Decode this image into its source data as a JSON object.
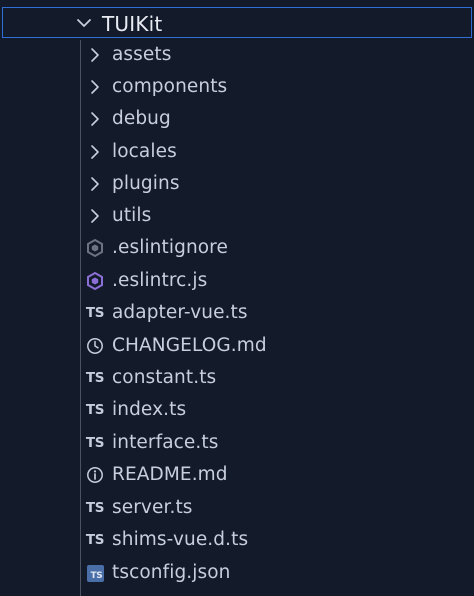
{
  "explorer": {
    "root": {
      "label": "TUIKit",
      "expanded": true,
      "icon": "chevron-down-icon"
    },
    "folders": [
      {
        "label": "assets",
        "icon": "chevron-right-icon"
      },
      {
        "label": "components",
        "icon": "chevron-right-icon"
      },
      {
        "label": "debug",
        "icon": "chevron-right-icon"
      },
      {
        "label": "locales",
        "icon": "chevron-right-icon"
      },
      {
        "label": "plugins",
        "icon": "chevron-right-icon"
      },
      {
        "label": "utils",
        "icon": "chevron-right-icon"
      }
    ],
    "files": [
      {
        "label": ".eslintignore",
        "icon": "eslint-ignore-icon"
      },
      {
        "label": ".eslintrc.js",
        "icon": "eslint-icon"
      },
      {
        "label": "adapter-vue.ts",
        "icon": "typescript-icon",
        "badge": "TS"
      },
      {
        "label": "CHANGELOG.md",
        "icon": "clock-icon"
      },
      {
        "label": "constant.ts",
        "icon": "typescript-icon",
        "badge": "TS"
      },
      {
        "label": "index.ts",
        "icon": "typescript-icon",
        "badge": "TS"
      },
      {
        "label": "interface.ts",
        "icon": "typescript-icon",
        "badge": "TS"
      },
      {
        "label": "README.md",
        "icon": "info-icon"
      },
      {
        "label": "server.ts",
        "icon": "typescript-icon",
        "badge": "TS"
      },
      {
        "label": "shims-vue.d.ts",
        "icon": "typescript-icon",
        "badge": "TS"
      },
      {
        "label": "tsconfig.json",
        "icon": "tsconfig-icon",
        "badge": "TS"
      }
    ]
  },
  "colors": {
    "background": "#131a2a",
    "selection_border": "#2f6fd6",
    "text": "#c8cedb",
    "eslint": "#8b6fd6",
    "tsconfig": "#4a6ea8"
  }
}
